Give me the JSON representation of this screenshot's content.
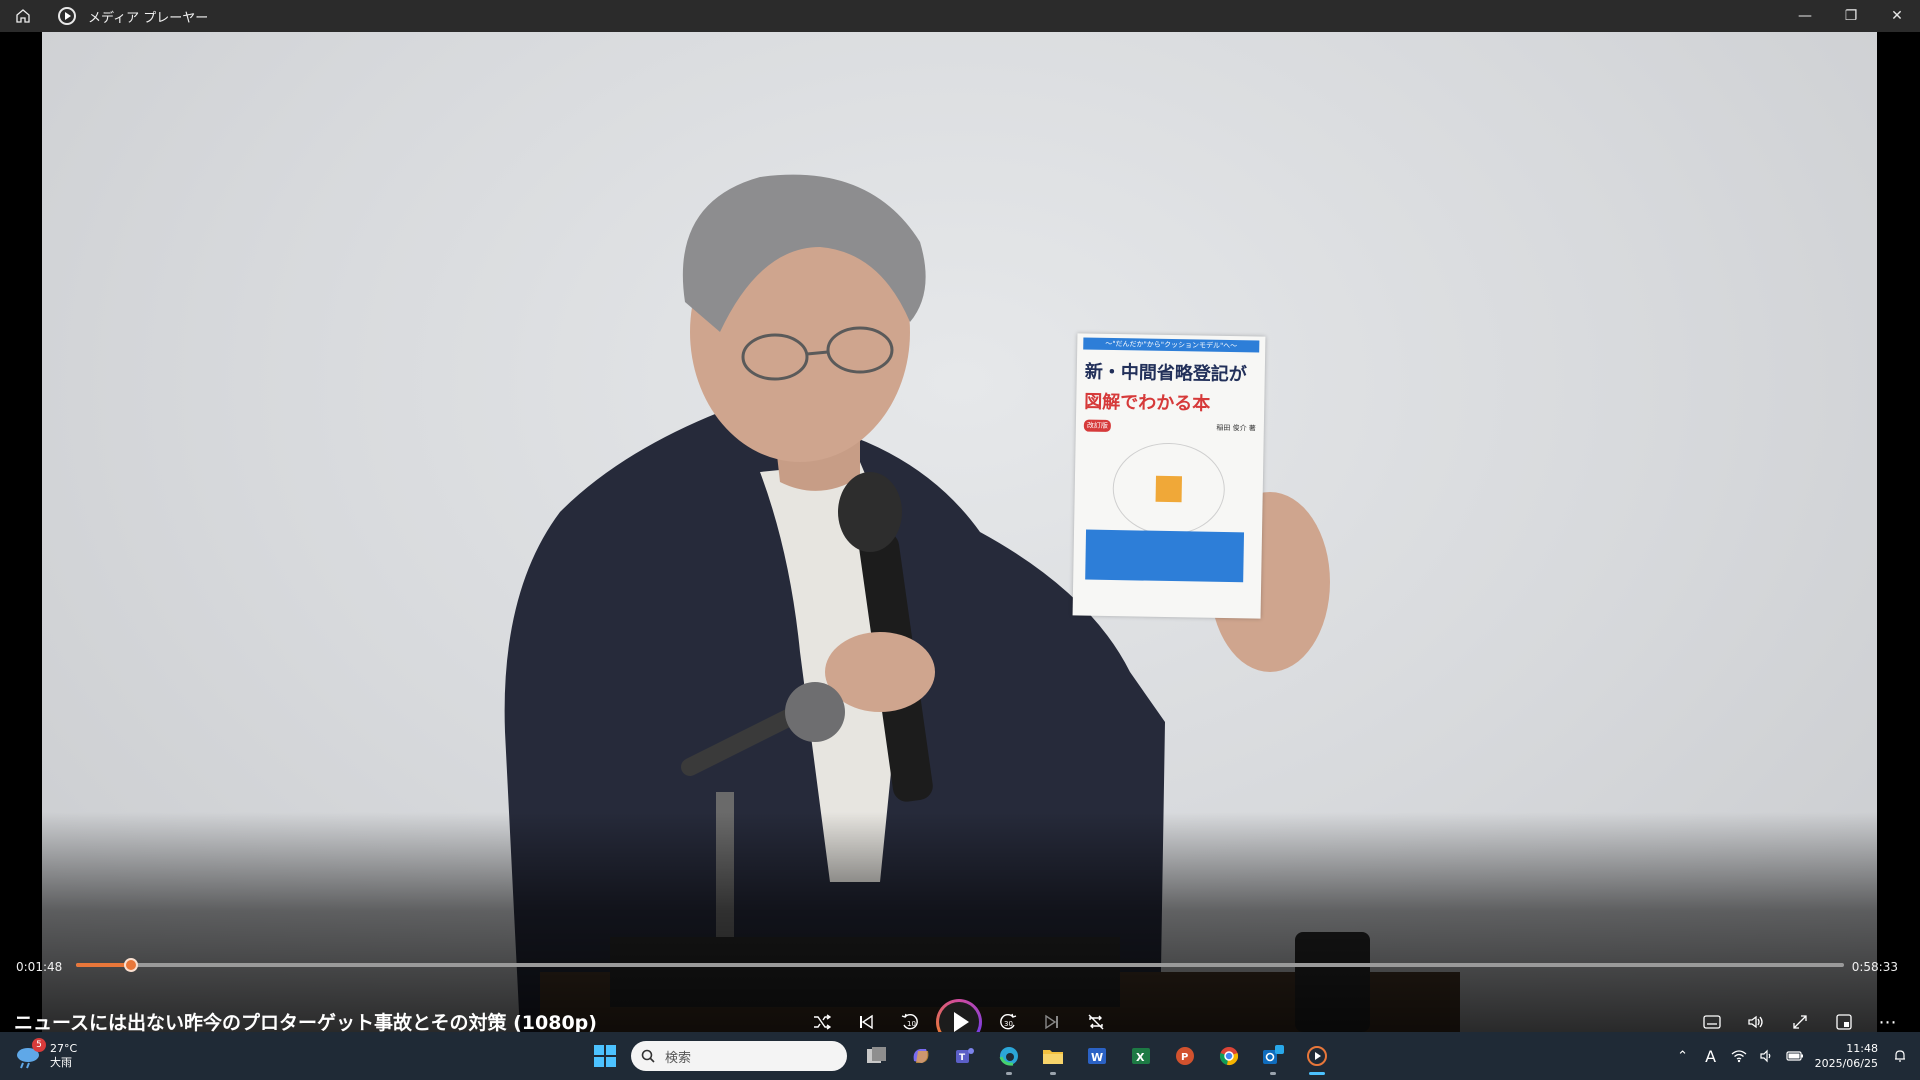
{
  "window": {
    "title": "メディア プレーヤー",
    "home_icon": "home-icon",
    "minimize_glyph": "—",
    "restore_glyph": "❐",
    "close_glyph": "✕"
  },
  "player": {
    "current_time": "0:01:48",
    "total_time": "0:58:33",
    "progress_fraction": 0.031,
    "video_title": "ニュースには出ない昨今のプロターゲット事故とその対策 (1080p)",
    "accent_color": "#e8773a"
  },
  "book": {
    "tagline": "〜\"だんだか\"から\"クッションモデル\"へ〜",
    "title_line1": "新・中間省略登記が",
    "title_line2": "図解でわかる本",
    "edition": "改訂版",
    "author": "稲田 俊介 著"
  },
  "taskbar": {
    "weather_temp": "27°C",
    "weather_desc": "大雨",
    "weather_badge": "5",
    "search_placeholder": "検索",
    "ime_indicator": "A",
    "time": "11:48",
    "date": "2025/06/25"
  }
}
